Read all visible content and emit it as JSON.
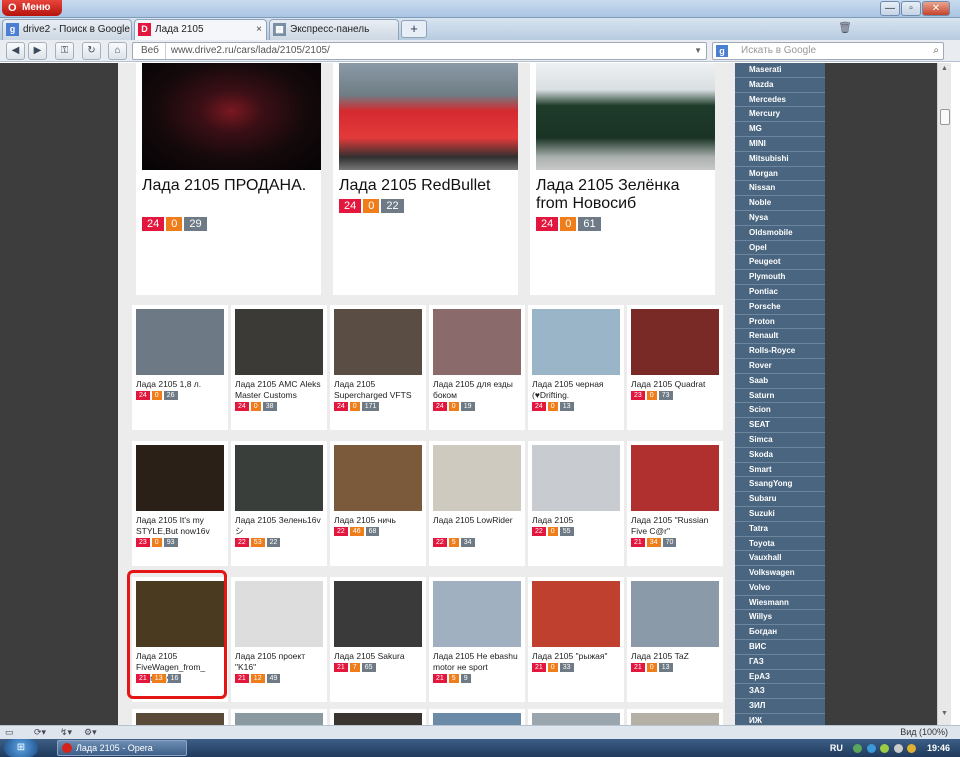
{
  "browser": {
    "menu_label": "Меню",
    "tabs": [
      {
        "label": "drive2 - Поиск в Google",
        "icon": "google-icon"
      },
      {
        "label": "Лада 2105",
        "icon": "drive2-icon"
      },
      {
        "label": "Экспресс-панель",
        "icon": "speed-dial-icon"
      }
    ],
    "web_label": "Веб",
    "url": "www.drive2.ru/cars/lada/2105/2105/",
    "search_placeholder": "Искать в Google",
    "zoom": "Вид (100%)"
  },
  "featured": [
    {
      "title": "Лада 2105 ПРОДАНА.",
      "stats": [
        "24",
        "0",
        "29"
      ]
    },
    {
      "title": "Лада 2105 RedBullet",
      "stats": [
        "24",
        "0",
        "22"
      ]
    },
    {
      "title": "Лада 2105 Зелёнка from Новосиб",
      "stats": [
        "24",
        "0",
        "61"
      ]
    }
  ],
  "cars": [
    {
      "title": "Лада 2105 1,8 л.",
      "stats": [
        "24",
        "0",
        "26"
      ]
    },
    {
      "title": "Лада 2105 АМС Aleks Master Customs",
      "stats": [
        "24",
        "0",
        "38"
      ]
    },
    {
      "title": "Лада 2105 Supercharged VFTS",
      "stats": [
        "24",
        "0",
        "171"
      ]
    },
    {
      "title": "Лада 2105 для езды боком",
      "stats": [
        "24",
        "0",
        "19"
      ]
    },
    {
      "title": "Лада 2105 черная (♥Drifting.",
      "stats": [
        "24",
        "0",
        "13"
      ]
    },
    {
      "title": "Лада 2105 Quadrat",
      "stats": [
        "23",
        "0",
        "73"
      ]
    },
    {
      "title": "Лада 2105 It's my STYLE,But now16v",
      "stats": [
        "23",
        "0",
        "93"
      ]
    },
    {
      "title": "Лада 2105 Зелень16v シ",
      "stats": [
        "22",
        "53",
        "22"
      ]
    },
    {
      "title": "Лада 2105 ничь",
      "stats": [
        "22",
        "46",
        "68"
      ]
    },
    {
      "title": "Лада 2105 LowRider",
      "stats": [
        "22",
        "5",
        "34"
      ]
    },
    {
      "title": "Лада 2105",
      "stats": [
        "22",
        "0",
        "55"
      ]
    },
    {
      "title": "Лада 2105 \"Russian Five C@r\"",
      "stats": [
        "21",
        "34",
        "70"
      ]
    },
    {
      "title": "Лада 2105 FiveWagen_from_ Germany",
      "stats": [
        "21",
        "13",
        "16"
      ]
    },
    {
      "title": "Лада 2105 проект \"K16\"",
      "stats": [
        "21",
        "12",
        "49"
      ]
    },
    {
      "title": "Лада 2105 Sakura",
      "stats": [
        "21",
        "7",
        "65"
      ]
    },
    {
      "title": "Лада 2105 Не ebashu motor не sport",
      "stats": [
        "21",
        "5",
        "9"
      ]
    },
    {
      "title": "Лада 2105 \"рыжая\"",
      "stats": [
        "21",
        "0",
        "33"
      ]
    },
    {
      "title": "Лада 2105 TaZ",
      "stats": [
        "21",
        "0",
        "13"
      ]
    }
  ],
  "brands": [
    "Maserati",
    "Mazda",
    "Mercedes",
    "Mercury",
    "MG",
    "MINI",
    "Mitsubishi",
    "Morgan",
    "Nissan",
    "Noble",
    "Nysa",
    "Oldsmobile",
    "Opel",
    "Peugeot",
    "Plymouth",
    "Pontiac",
    "Porsche",
    "Proton",
    "Renault",
    "Rolls-Royce",
    "Rover",
    "Saab",
    "Saturn",
    "Scion",
    "SEAT",
    "Simca",
    "Skoda",
    "Smart",
    "SsangYong",
    "Subaru",
    "Suzuki",
    "Tatra",
    "Toyota",
    "Vauxhall",
    "Volkswagen",
    "Volvo",
    "Wiesmann",
    "Willys",
    "Богдан",
    "ВИС",
    "ГАЗ",
    "ЕрАЗ",
    "ЗАЗ",
    "ЗИЛ",
    "ИЖ"
  ],
  "taskbar": {
    "task_label": "Лада 2105 - Opera",
    "lang": "RU",
    "time": "19:46"
  },
  "colors": {
    "like": "#e3173e",
    "comment": "#ef7d1a",
    "views": "#6e7a85",
    "sidebar": "#49657f"
  }
}
